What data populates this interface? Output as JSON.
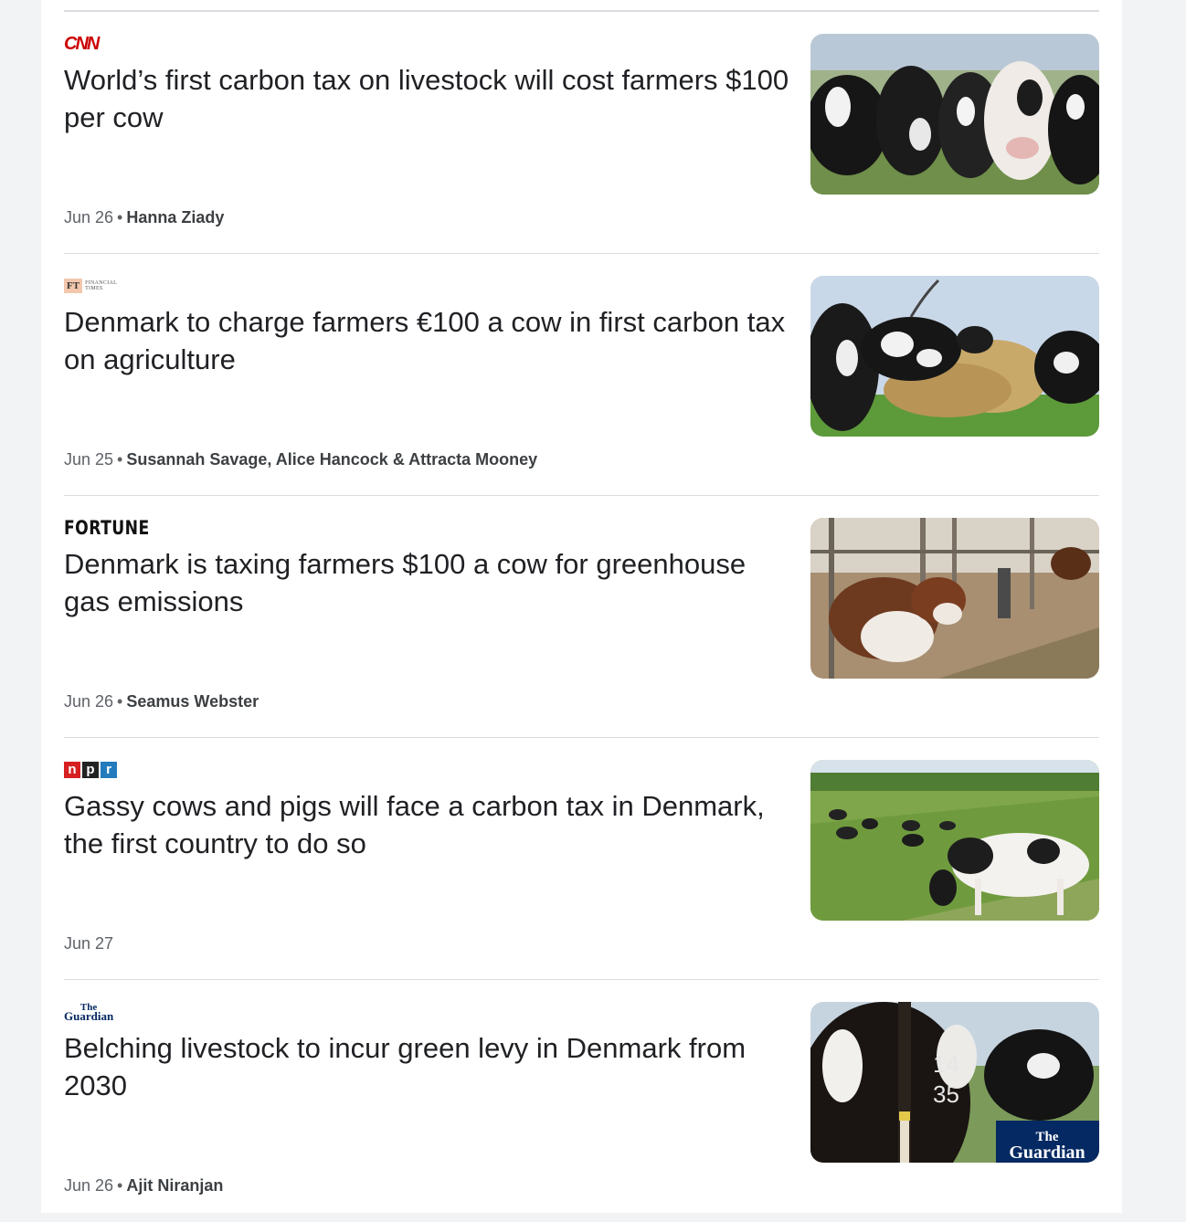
{
  "articles": [
    {
      "source": "CNN",
      "logo_color": "#cc0000",
      "headline": "World’s first carbon tax on livestock will cost farmers $100 per cow",
      "date": "Jun 26",
      "author": "Hanna Ziady",
      "image": "cows-in-field-closeup"
    },
    {
      "source": "Financial Times",
      "logo_box": "FT",
      "logo_text_1": "FINANCIAL",
      "logo_text_2": "TIMES",
      "headline": "Denmark to charge farmers €100 a cow in first carbon tax on agriculture",
      "date": "Jun 25",
      "author": "Susannah Savage, Alice Hancock & Attracta Mooney",
      "image": "cows-eating-hay"
    },
    {
      "source": "FORTUNE",
      "headline": "Denmark is taxing farmers $100 a cow for greenhouse gas emissions",
      "date": "Jun 26",
      "author": "Seamus Webster",
      "image": "cows-in-barn"
    },
    {
      "source": "NPR",
      "logo_letters": [
        "n",
        "p",
        "r"
      ],
      "logo_colors": [
        "#d62021",
        "#222222",
        "#237bbd"
      ],
      "headline": "Gassy cows and pigs will face a carbon tax in Denmark, the first country to do so",
      "date": "Jun 27",
      "author": "",
      "image": "cows-grazing-pasture"
    },
    {
      "source": "The Guardian",
      "logo_the": "The",
      "logo_name": "Guardian",
      "headline": "Belching livestock to incur green levy in Denmark from 2030",
      "date": "Jun 26",
      "author": "Ajit Niranjan",
      "image": "cow-rear-closeup",
      "image_watermark_the": "The",
      "image_watermark_name": "Guardian",
      "image_tag_number_1": "14",
      "image_tag_number_2": "35"
    }
  ]
}
